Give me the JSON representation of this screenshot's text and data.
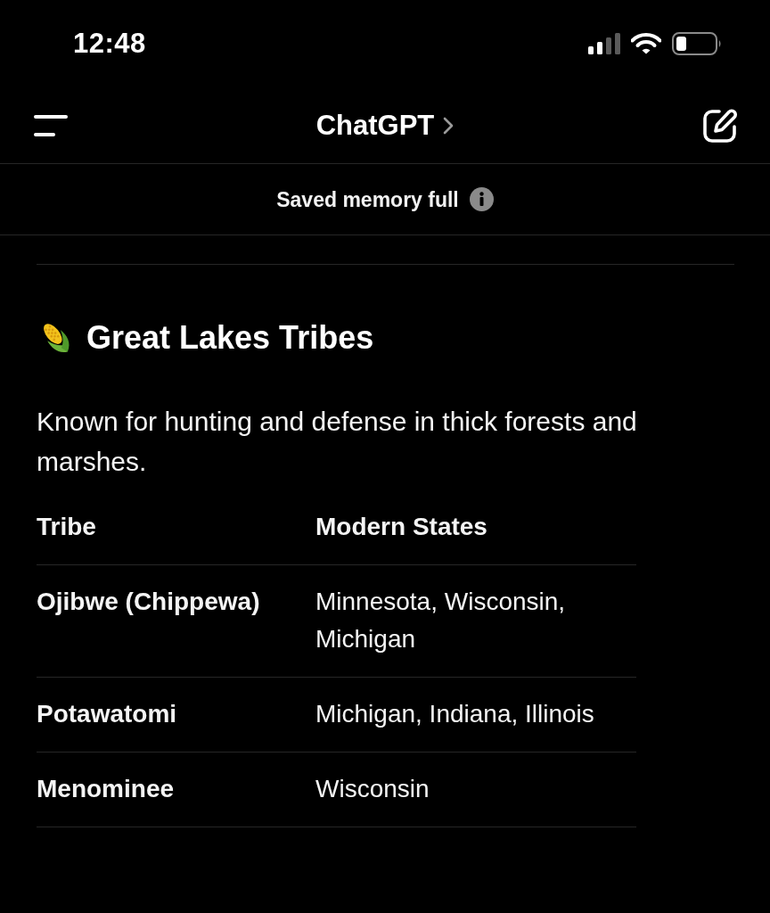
{
  "status_bar": {
    "time": "12:48"
  },
  "nav_bar": {
    "title": "ChatGPT"
  },
  "banner": {
    "text": "Saved memory full"
  },
  "message": {
    "heading": "Great Lakes Tribes",
    "paragraph": "Known for hunting and defense in thick forests and marshes.",
    "table": {
      "columns": [
        "Tribe",
        "Modern States"
      ],
      "rows": [
        [
          "Ojibwe (Chippewa)",
          "Minnesota, Wisconsin, Michigan"
        ],
        [
          "Potawatomi",
          "Michigan, Indiana, Illinois"
        ],
        [
          "Menominee",
          "Wisconsin"
        ]
      ]
    }
  }
}
